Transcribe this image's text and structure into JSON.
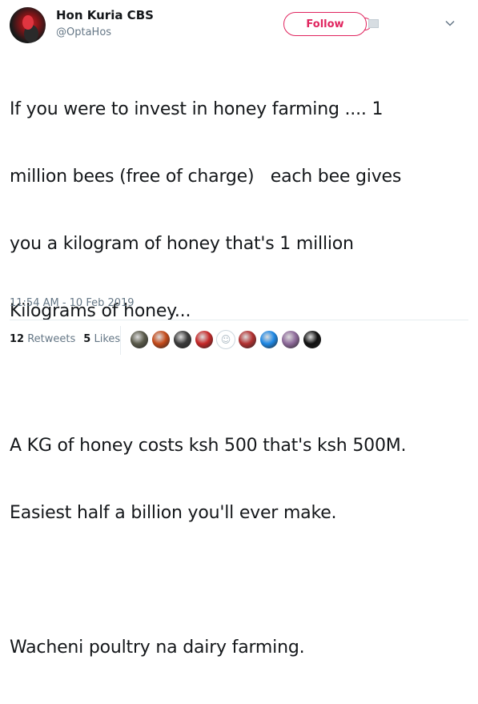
{
  "author": {
    "display_name": "Hon Kuria CBS",
    "handle": "@OptaHos",
    "avatar_icon": "profile-photo"
  },
  "actions": {
    "follow_label": "Follow",
    "caret_icon": "chevron-down-icon"
  },
  "tweet": {
    "lines_p1": [
      "If you were to invest in honey farming .... 1",
      "million bees (free of charge)   each bee gives",
      "you a kilogram of honey that's 1 million",
      "Kilograms of honey..."
    ],
    "lines_p2": [
      "A KG of honey costs ksh 500 that's ksh 500M.",
      "Easiest half a billion you'll ever make."
    ],
    "lines_p3": [
      "Wacheni poultry na dairy farming."
    ],
    "timestamp": "11:54 AM - 10 Feb 2019"
  },
  "stats": {
    "retweets_count": "12",
    "retweets_label": "Retweets",
    "likes_count": "5",
    "likes_label": "Likes"
  },
  "likers": [
    {
      "name": "liker-avatar-1",
      "color": "#5a5a4a"
    },
    {
      "name": "liker-avatar-2",
      "color": "#c44a1a"
    },
    {
      "name": "liker-avatar-3",
      "color": "#3a3a3a"
    },
    {
      "name": "liker-avatar-4",
      "color": "#c62828"
    },
    {
      "name": "liker-avatar-default",
      "color": "#ffffff"
    },
    {
      "name": "liker-avatar-6",
      "color": "#b23030"
    },
    {
      "name": "liker-avatar-7",
      "color": "#1e88e5"
    },
    {
      "name": "liker-avatar-8",
      "color": "#8e6a9a"
    },
    {
      "name": "liker-avatar-9",
      "color": "#111111"
    }
  ],
  "colors": {
    "follow_accent": "#e0245e",
    "secondary_text": "#657786",
    "primary_text": "#14171a"
  }
}
